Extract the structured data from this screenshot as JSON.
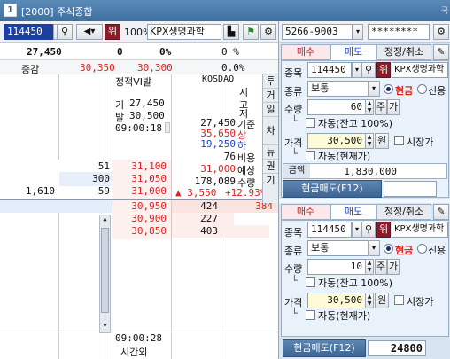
{
  "window": {
    "number": "1",
    "title": "[2000] 주식종합",
    "corner": "국"
  },
  "toolbar": {
    "code": "114450",
    "badge": "위",
    "percent": "100%",
    "stock_name": "KPX생명과학"
  },
  "summary": {
    "price": "27,450",
    "change": "0",
    "rate": "0%",
    "volume_rate": "0 %",
    "label_change": "증감",
    "ask_total": "30,350",
    "bid_total": "30,300",
    "net_rate": "0.0%"
  },
  "info": {
    "title": "정적VI발",
    "line1_label": "기",
    "line1_val": "27,450",
    "line2_label": "발",
    "line2_val": "30,500",
    "time": "09:00:18",
    "market": "KOSDAQ",
    "base": "27,450",
    "base_label": "기준",
    "high": "35,650",
    "high_label": "상",
    "low": "19,250",
    "low_label": "하",
    "ratio": "76",
    "ratio_label": "비용",
    "exp_price": "31,000",
    "exp_label": "예상",
    "exp_qty": "178,089",
    "exp_qty_label": "수량",
    "exp_change": "▲ 3,550",
    "exp_rate": "+12.93%",
    "v_labels": [
      "시",
      "고",
      "저"
    ]
  },
  "side_tabs": [
    "투",
    "거",
    "일",
    "차",
    "뉴",
    "권",
    "기"
  ],
  "asks": [
    {
      "qty": "51",
      "price": "31,100"
    },
    {
      "qty": "300",
      "price": "31,050"
    },
    {
      "qty": "59",
      "price": "31,000",
      "left": "1,610"
    }
  ],
  "bids": [
    {
      "price": "30,950",
      "qty": "424",
      "extra": "384"
    },
    {
      "price": "30,900",
      "qty": "227"
    },
    {
      "price": "30,850",
      "qty": "403"
    }
  ],
  "bottom": {
    "time": "09:00:28",
    "label": "시간외"
  },
  "account": {
    "number": "5266-9003",
    "password": "********"
  },
  "order_top": {
    "tabs": [
      "매수",
      "매도",
      "정정/취소"
    ],
    "code": "114450",
    "badge": "위",
    "name": "KPX생명과학",
    "type": "보통",
    "cash": "현금",
    "credit": "신용",
    "qty": "60",
    "qty_unit": "주",
    "qty_btn": "가",
    "auto_qty": "자동(잔고 100%)",
    "price": "30,500",
    "price_unit": "원",
    "market": "시장가",
    "auto_price": "자동(현재가)",
    "amount_label": "금액",
    "amount": "1,830,000",
    "sell": "현금매도(F12)",
    "labels": {
      "code": "종목",
      "type": "종류",
      "qty": "수량",
      "price": "가격"
    }
  },
  "order_bottom": {
    "tabs": [
      "매수",
      "매도",
      "정정/취소"
    ],
    "code": "114450",
    "badge": "위",
    "name": "KPX생명과학",
    "type": "보통",
    "cash": "현금",
    "credit": "신용",
    "qty": "10",
    "qty_unit": "주",
    "qty_btn": "가",
    "auto_qty": "자동(잔고 100%)",
    "price": "30,500",
    "price_unit": "원",
    "market": "시장가",
    "auto_price": "자동(현재가)",
    "sell": "현금매도(F12)",
    "sell_value": "24800",
    "labels": {
      "code": "종목",
      "type": "종류",
      "qty": "수량",
      "price": "가격"
    }
  }
}
